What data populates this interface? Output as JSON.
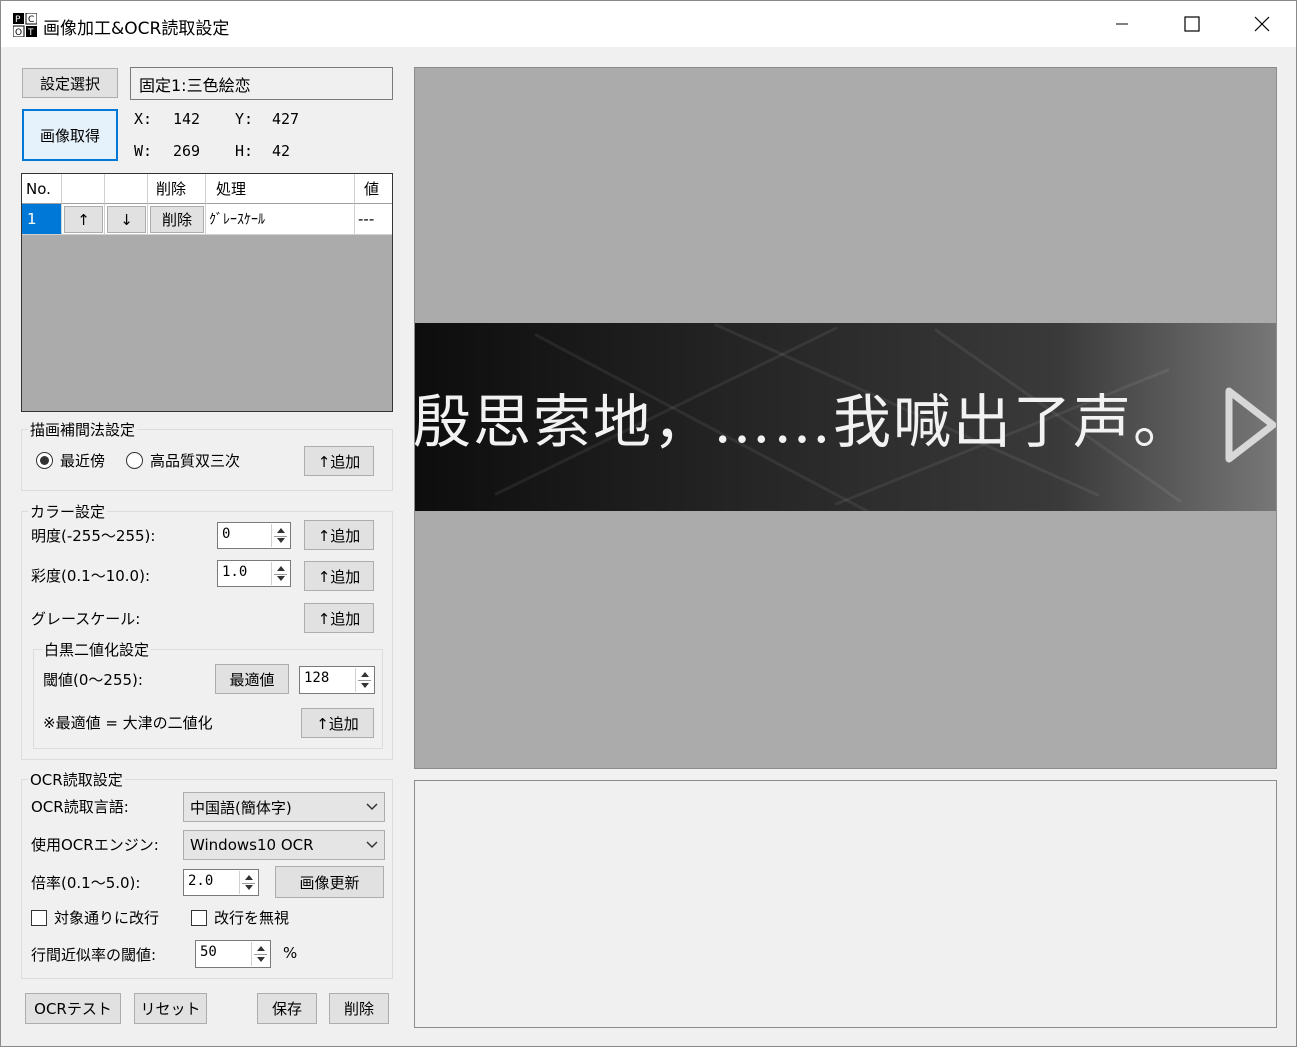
{
  "window": {
    "title": "画像加工&OCR読取設定",
    "minimize": "—",
    "maximize": "☐",
    "close": "✕"
  },
  "setting": {
    "select_button": "設定選択",
    "current": "固定1:三色絵恋"
  },
  "capture": {
    "button": "画像取得",
    "x_label": "X:",
    "x": "142",
    "y_label": "Y:",
    "y": "427",
    "w_label": "W:",
    "w": "269",
    "h_label": "H:",
    "h": "42"
  },
  "grid": {
    "headers": [
      "No.",
      "",
      "",
      "削除",
      "処理",
      "値"
    ],
    "rows": [
      {
        "no": "1",
        "up": "↑",
        "down": "↓",
        "delete": "削除",
        "process": "ｸﾞﾚｰｽｹｰﾙ",
        "value": "---"
      }
    ]
  },
  "interp": {
    "label": "描画補間法設定",
    "opt1": "最近傍",
    "opt2": "高品質双三次",
    "selected": "最近傍",
    "add": "↑追加"
  },
  "color": {
    "label": "カラー設定",
    "brightness_label": "明度(-255〜255):",
    "brightness": "0",
    "brightness_add": "↑追加",
    "saturation_label": "彩度(0.1〜10.0):",
    "saturation": "1.0",
    "saturation_add": "↑追加",
    "gray_label": "グレースケール:",
    "gray_add": "↑追加"
  },
  "binary": {
    "label": "白黒二値化設定",
    "threshold_label": "閾値(0〜255):",
    "optimal_button": "最適値",
    "threshold": "128",
    "note": "※最適値 = 大津の二値化",
    "add": "↑追加"
  },
  "ocr": {
    "label": "OCR読取設定",
    "lang_label": "OCR読取言語:",
    "lang": "中国語(簡体字)",
    "engine_label": "使用OCRエンジン:",
    "engine": "Windows10 OCR",
    "scale_label": "倍率(0.1〜5.0):",
    "scale": "2.0",
    "refresh_button": "画像更新",
    "chk1": "対象通りに改行",
    "chk2": "改行を無視",
    "sim_label": "行間近似率の閾値:",
    "sim": "50",
    "sim_unit": "%"
  },
  "bottom": {
    "ocr_test": "OCRテスト",
    "reset": "リセット",
    "save": "保存",
    "delete": "削除"
  },
  "preview": {
    "text": "殷思索地，……我喊出了声。"
  }
}
